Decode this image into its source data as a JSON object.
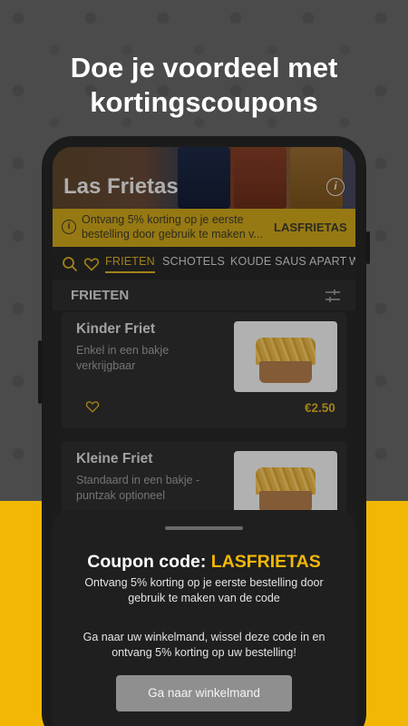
{
  "headline": {
    "line1": "Doe je voordeel met",
    "line2": "kortingscoupons"
  },
  "store": {
    "name": "Las Frietas",
    "info_icon": "info-icon"
  },
  "coupon_bar": {
    "text_line1": "Ontvang 5% korting op je eerste",
    "text_line2": "bestelling door gebruik te maken v...",
    "code": "LASFRIETAS"
  },
  "tabs": {
    "icons": [
      "search-icon",
      "heart-icon"
    ],
    "items": [
      "FRIETEN",
      "SCHOTELS",
      "KOUDE SAUS APART",
      "W"
    ],
    "active": "FRIETEN"
  },
  "section": {
    "title": "FRIETEN",
    "filter_icon": "filter-icon"
  },
  "products": [
    {
      "name": "Kinder Friet",
      "description": "Enkel in een bakje verkrijgbaar",
      "price": "€2.50"
    },
    {
      "name": "Kleine Friet",
      "description": "Standaard in een bakje - puntzak optioneel",
      "price": ""
    }
  ],
  "coupon_sheet": {
    "title_prefix": "Coupon code:",
    "title_code": "LASFRIETAS",
    "description": "Ontvang 5% korting op je eerste bestelling door gebruik te maken van de code",
    "instruction": "Ga naar uw winkelmand, wissel deze code in en ontvang 5% korting op uw bestelling!",
    "button_label": "Ga naar winkelmand"
  },
  "colors": {
    "accent": "#f2b705",
    "price": "#d9ad22",
    "coupon_bar": "#c9a21a"
  }
}
